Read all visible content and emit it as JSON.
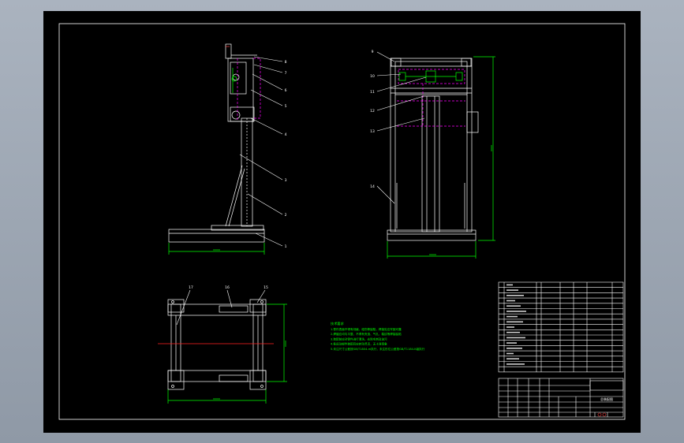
{
  "colors": {
    "background": "#000000",
    "frame": "#ffffff",
    "dimension": "#00ff00",
    "hidden": "#ff00ff",
    "center_line": "#ff2020",
    "accent": "#ff4040",
    "title_block_text": "#ffffff"
  },
  "balloons": {
    "side_view": [
      "8",
      "7",
      "6",
      "5",
      "4",
      "3",
      "2",
      "1"
    ],
    "front_view": [
      "9",
      "10",
      "11",
      "12",
      "13",
      "14"
    ],
    "top_view": [
      "17",
      "16",
      "15"
    ]
  },
  "notes": {
    "heading": "技术要求",
    "lines": [
      "1.零件表面不得有划痕、碰伤等缺陷，焊接处应牢固可靠",
      "2.焊缝应均匀平整，不得有夹渣、气孔、裂纹等焊接缺陷",
      "3.装配前应对零件进行清洗，去除毛刺及油污",
      "4.各运动部件装配后应转动灵活，无卡滞现象",
      "5.未注尺寸公差按GB/T1804-m执行，未注形位公差按GB/T1184-K级执行"
    ]
  },
  "title_block": {
    "drawing_title": "总装配图"
  }
}
